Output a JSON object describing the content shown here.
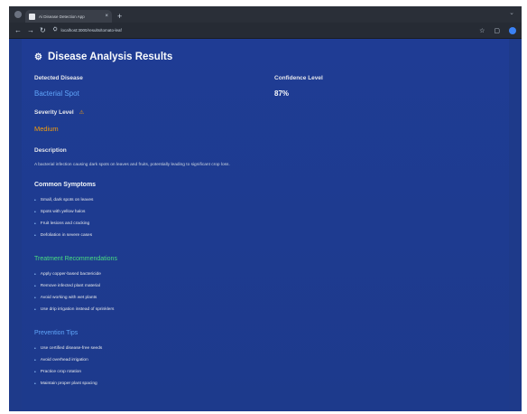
{
  "browser": {
    "tab_title": "Ai Disease Detection App",
    "tab_close": "×",
    "new_tab": "+",
    "address": "localhost:3000/results/tomato-leaf"
  },
  "results": {
    "title": "Disease Analysis Results",
    "detected_label": "Detected Disease",
    "detected_value": "Bacterial Spot",
    "confidence_label": "Confidence Level",
    "confidence_value": "87%",
    "severity_label": "Severity Level",
    "severity_value": "Medium",
    "description_label": "Description",
    "description_text": "A bacterial infection causing dark spots on leaves and fruits, potentially leading to significant crop loss."
  },
  "sections": {
    "symptoms": {
      "title": "Common Symptoms",
      "items": [
        "Small, dark spots on leaves",
        "Spots with yellow halos",
        "Fruit lesions and cracking",
        "Defoliation in severe cases"
      ]
    },
    "treatment": {
      "title": "Treatment Recommendations",
      "items": [
        "Apply copper-based bactericide",
        "Remove infected plant material",
        "Avoid working with wet plants",
        "Use drip irrigation instead of sprinklers"
      ]
    },
    "prevention": {
      "title": "Prevention Tips",
      "items": [
        "Use certified disease-free seeds",
        "Avoid overhead irrigation",
        "Practice crop rotation",
        "Maintain proper plant spacing"
      ]
    }
  },
  "colors": {
    "page_background": "#1e3a8a",
    "disease_text": "#60a5fa",
    "severity_text": "#f59e0b",
    "treatment_title": "#4ade80",
    "prevention_title": "#60a5fa"
  }
}
